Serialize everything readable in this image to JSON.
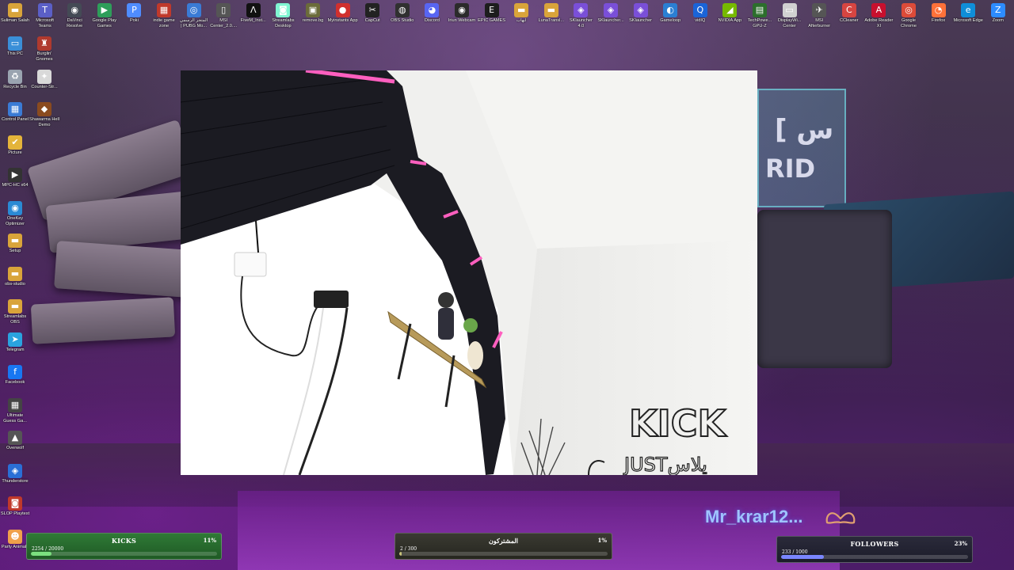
{
  "desktop": {
    "top_icons": [
      {
        "label": "Suliman Salah",
        "icon": "folder-icon",
        "color": "#d9a43a",
        "glyph": "▬"
      },
      {
        "label": "Microsoft Teams",
        "icon": "teams-icon",
        "color": "#5b5fc7",
        "glyph": "T"
      },
      {
        "label": "DaVinci Resolve",
        "icon": "davinci-icon",
        "color": "#444a55",
        "glyph": "◉"
      },
      {
        "label": "Google Play Games",
        "icon": "play-games-icon",
        "color": "#2e9e5a",
        "glyph": "▶"
      },
      {
        "label": "Poki",
        "icon": "poki-icon",
        "color": "#4f8cff",
        "glyph": "P"
      },
      {
        "label": "indie game zone",
        "icon": "indie-game-icon",
        "color": "#c0392b",
        "glyph": "▦"
      },
      {
        "label": "المتجر الرسمي | PUBG Mo...",
        "icon": "pubg-store-icon",
        "color": "#3a7bd5",
        "glyph": "◎"
      },
      {
        "label": "MSI Center_2.0....",
        "icon": "msi-center-icon",
        "color": "#555555",
        "glyph": "▯"
      },
      {
        "label": "FiveM_Inst...",
        "icon": "fivem-icon",
        "color": "#111111",
        "glyph": "Λ"
      },
      {
        "label": "Streamlabs Desktop",
        "icon": "streamlabs-icon",
        "color": "#80f5d2",
        "glyph": "◙"
      },
      {
        "label": "remove.bg",
        "icon": "removebg-icon",
        "color": "#6b6b3a",
        "glyph": "▣"
      },
      {
        "label": "Myinstants App",
        "icon": "myinstants-icon",
        "color": "#d0302e",
        "glyph": "●"
      },
      {
        "label": "CapCut",
        "icon": "capcut-icon",
        "color": "#222222",
        "glyph": "✂"
      },
      {
        "label": "OBS Studio",
        "icon": "obs-icon",
        "color": "#303030",
        "glyph": "◍"
      },
      {
        "label": "Discord",
        "icon": "discord-icon",
        "color": "#5865f2",
        "glyph": "◕"
      },
      {
        "label": "Iriun Webcam",
        "icon": "iriun-webcam-icon",
        "color": "#2b2b2b",
        "glyph": "◉"
      },
      {
        "label": "EPIC GAMES",
        "icon": "epic-games-icon",
        "color": "#1d1d1d",
        "glyph": "E"
      },
      {
        "label": "ايهاب",
        "icon": "folder-icon",
        "color": "#d9a43a",
        "glyph": "▬"
      },
      {
        "label": "LunaTransl...",
        "icon": "folder-icon",
        "color": "#d9a43a",
        "glyph": "▬"
      },
      {
        "label": "SKlauncher 4.0",
        "icon": "sklauncher-icon",
        "color": "#7a4fd8",
        "glyph": "◈"
      },
      {
        "label": "SKlauncher...",
        "icon": "sklauncher-icon",
        "color": "#7a4fd8",
        "glyph": "◈"
      },
      {
        "label": "SKlauncher",
        "icon": "sklauncher-icon",
        "color": "#7a4fd8",
        "glyph": "◈"
      },
      {
        "label": "Gameloop",
        "icon": "gameloop-icon",
        "color": "#2b7fd3",
        "glyph": "◐"
      },
      {
        "label": "vidIQ",
        "icon": "vidiq-icon",
        "color": "#1a64d8",
        "glyph": "Q"
      },
      {
        "label": "NVIDIA App",
        "icon": "nvidia-icon",
        "color": "#76b900",
        "glyph": "◢"
      },
      {
        "label": "TechPowe... GPU-Z",
        "icon": "gpuz-icon",
        "color": "#2c6e2c",
        "glyph": "▤"
      },
      {
        "label": "DisplayWi... Center",
        "icon": "displaywidget-icon",
        "color": "#d1d1d1",
        "glyph": "▭"
      },
      {
        "label": "MSI Afterburner",
        "icon": "afterburner-icon",
        "color": "#555555",
        "glyph": "✈"
      },
      {
        "label": "CCleaner",
        "icon": "ccleaner-icon",
        "color": "#d64541",
        "glyph": "C"
      },
      {
        "label": "Adobe Reader XI",
        "icon": "adobe-reader-icon",
        "color": "#c8102e",
        "glyph": "A"
      },
      {
        "label": "Google Chrome",
        "icon": "chrome-icon",
        "color": "#dd4b39",
        "glyph": "◎"
      },
      {
        "label": "Firefox",
        "icon": "firefox-icon",
        "color": "#ff7139",
        "glyph": "◔"
      },
      {
        "label": "Microsoft Edge",
        "icon": "edge-icon",
        "color": "#0f8ed8",
        "glyph": "e"
      },
      {
        "label": "Zoom",
        "icon": "zoom-icon",
        "color": "#2d8cff",
        "glyph": "Z"
      }
    ],
    "left_icons": [
      {
        "label": "This PC",
        "icon": "this-pc-icon",
        "color": "#3a8fd8",
        "glyph": "▭"
      },
      {
        "label": "Burglin' Gnomes",
        "icon": "burglin-gnomes-icon",
        "color": "#b03a2e",
        "glyph": "♜"
      },
      {
        "label": "Recycle Bin",
        "icon": "recycle-bin-icon",
        "color": "#9aa4b0",
        "glyph": "♻"
      },
      {
        "label": "Counter-Str...",
        "icon": "counter-strike-icon",
        "color": "#d9d9d9",
        "glyph": "✦"
      },
      {
        "label": "Control Panel",
        "icon": "control-panel-icon",
        "color": "#3a7bd5",
        "glyph": "▦"
      },
      {
        "label": "Shawarma Hell Demo",
        "icon": "shawarma-hell-icon",
        "color": "#8a4b1f",
        "glyph": "◆"
      },
      {
        "label": "Picture",
        "icon": "picture-icon",
        "color": "#e4b43a",
        "glyph": "✔"
      },
      {
        "label": "MPC-HC x64",
        "icon": "mpc-hc-icon",
        "color": "#333333",
        "glyph": "▶"
      },
      {
        "label": "OneKey Optimizer",
        "icon": "onekey-optimizer-icon",
        "color": "#2a8ad4",
        "glyph": "◉"
      },
      {
        "label": "Setup",
        "icon": "folder-icon",
        "color": "#d9a43a",
        "glyph": "▬"
      },
      {
        "label": "obs-studio",
        "icon": "folder-icon",
        "color": "#d9a43a",
        "glyph": "▬"
      },
      {
        "label": "Streamlabs OBS",
        "icon": "folder-icon",
        "color": "#d9a43a",
        "glyph": "▬"
      },
      {
        "label": "Telegram",
        "icon": "telegram-icon",
        "color": "#2aa3df",
        "glyph": "➤"
      },
      {
        "label": "Facebook",
        "icon": "facebook-icon",
        "color": "#1877f2",
        "glyph": "f"
      },
      {
        "label": "Ultimate Guess Ga...",
        "icon": "ultimate-guess-icon",
        "color": "#444444",
        "glyph": "▦"
      },
      {
        "label": "Overwolf",
        "icon": "overwolf-icon",
        "color": "#555555",
        "glyph": "▲"
      },
      {
        "label": "Thunderstore",
        "icon": "thunderstore-icon",
        "color": "#2a6fd6",
        "glyph": "◈"
      },
      {
        "label": "SLOP Playtest",
        "icon": "slop-playtest-icon",
        "color": "#c0392b",
        "glyph": "◙"
      },
      {
        "label": "Party Animals",
        "icon": "party-animals-icon",
        "color": "#f0a04b",
        "glyph": "☻"
      }
    ]
  },
  "camera": {
    "sign_line_1": "KICK",
    "sign_line_2": "JUSTيلاس"
  },
  "overlay": {
    "streamer_name": "Mr_krar12...",
    "goals": {
      "kicks": {
        "title": "KICKS",
        "count": "2254 / 20000",
        "percent": "11%",
        "progress": 0.11
      },
      "subscribers": {
        "title": "المشتركون",
        "count": "2 / 300",
        "percent": "1%",
        "progress": 0.01
      },
      "followers": {
        "title": "FOLLOWERS",
        "count": "233 / 1000",
        "percent": "23%",
        "progress": 0.23
      }
    }
  }
}
